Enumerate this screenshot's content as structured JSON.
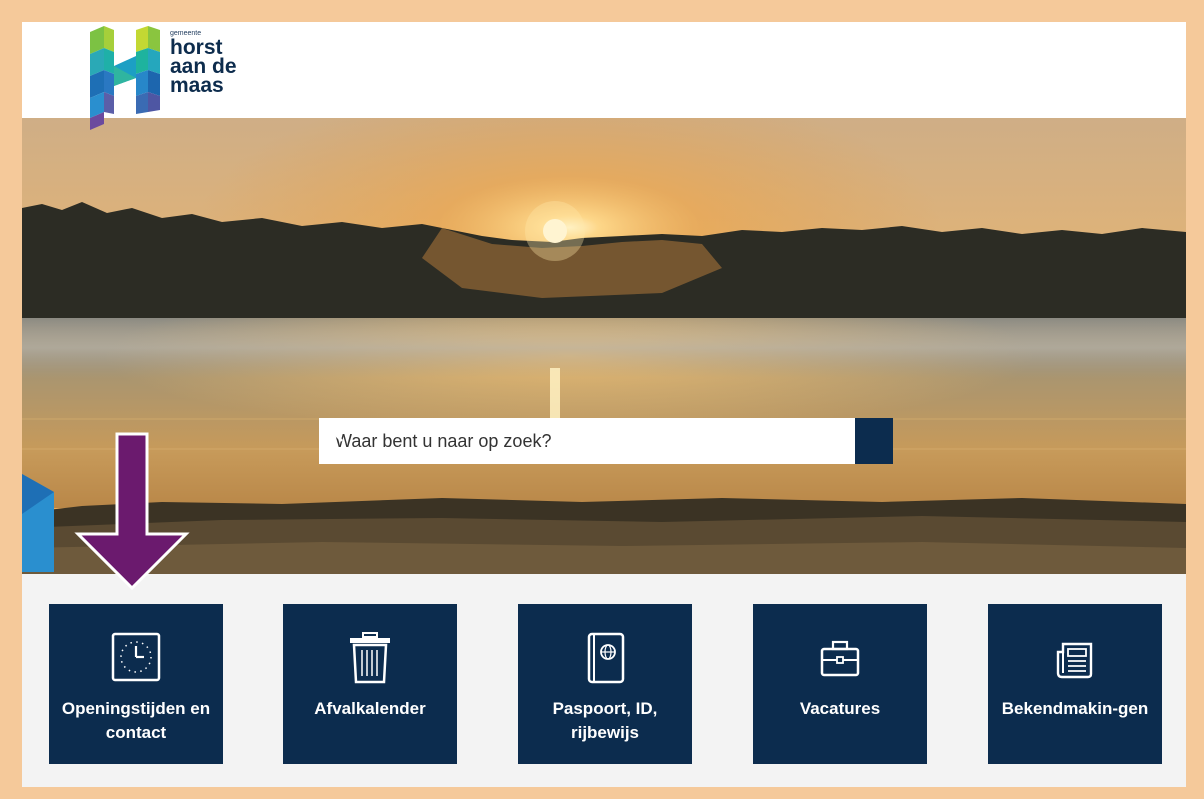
{
  "logo": {
    "small": "gemeente",
    "line1": "horst",
    "line2": "aan de",
    "line3": "maas"
  },
  "search": {
    "placeholder": "Waar bent u naar op zoek?",
    "button_icon": "search-icon"
  },
  "tiles": [
    {
      "label": "Openingstijden en contact",
      "icon": "clock-icon"
    },
    {
      "label": "Afvalkalender",
      "icon": "trash-icon"
    },
    {
      "label": "Paspoort, ID, rijbewijs",
      "icon": "passport-icon"
    },
    {
      "label": "Vacatures",
      "icon": "briefcase-icon"
    },
    {
      "label": "Bekendmakin-gen",
      "icon": "newspaper-icon"
    }
  ],
  "annotation": {
    "arrow_color": "#6b1a6e"
  },
  "colors": {
    "frame": "#f5c99a",
    "brand_navy": "#0c2c4e",
    "tile_area": "#f3f3f3"
  }
}
